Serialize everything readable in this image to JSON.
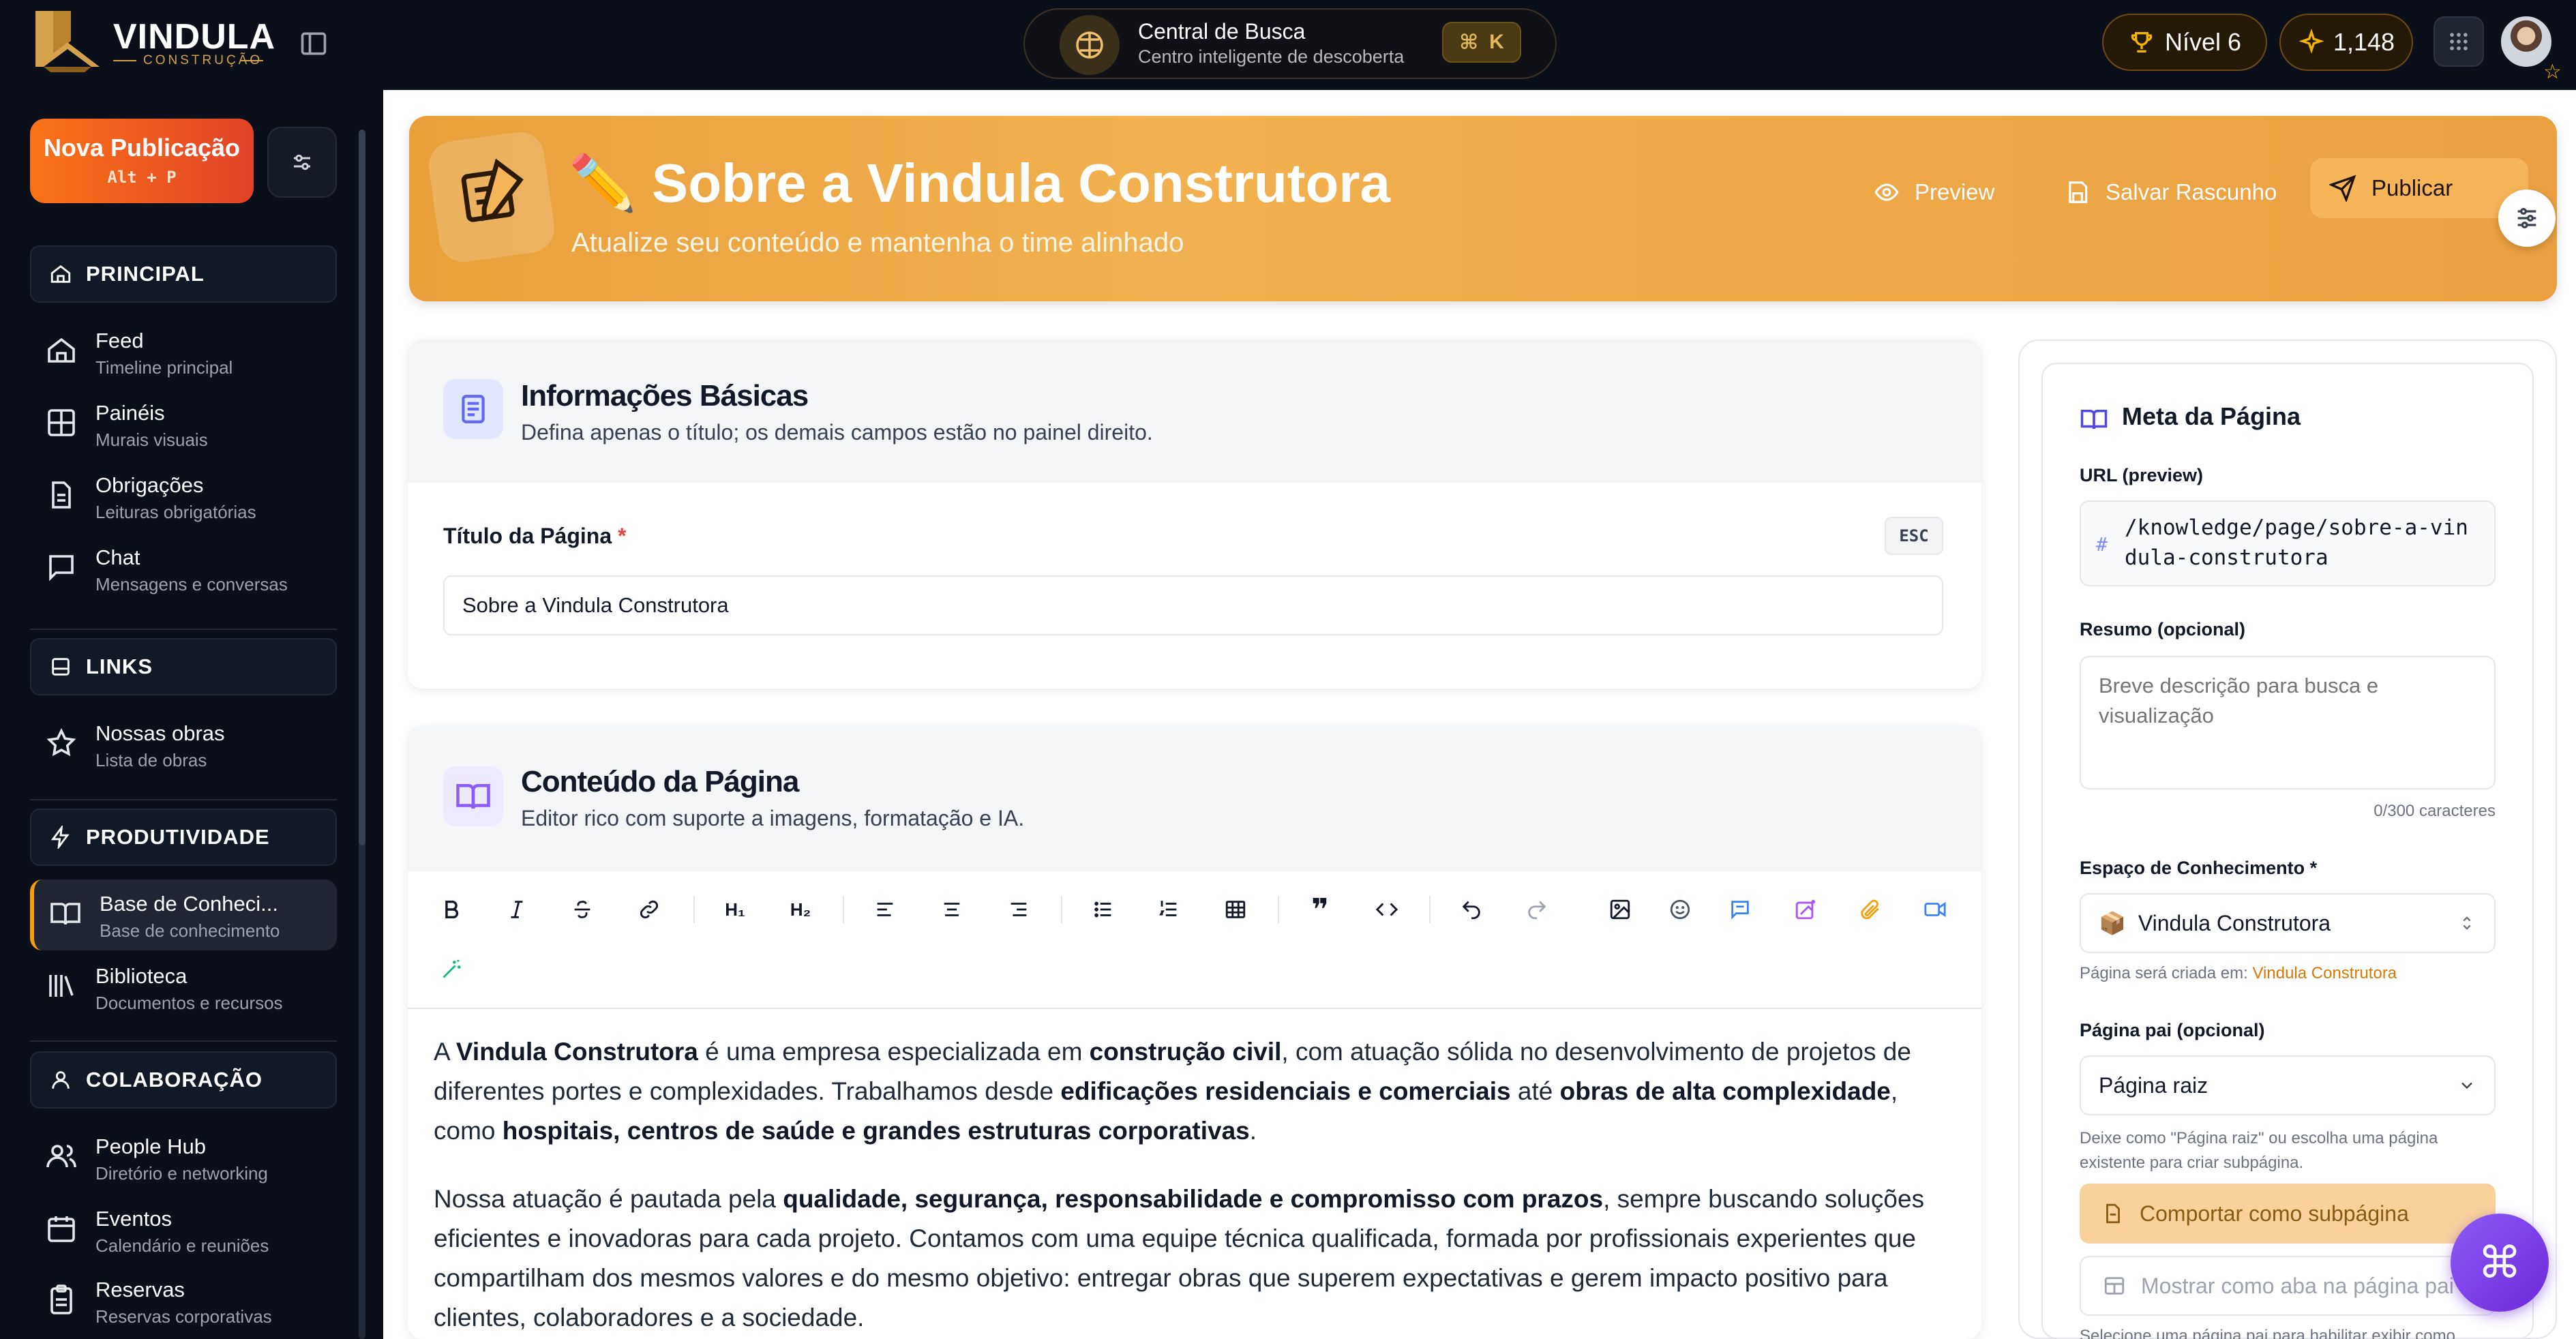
{
  "topbar": {
    "brand": "VINDULA",
    "brand_sub": "CONSTRUÇÃO",
    "search_title": "Central de Busca",
    "search_sub": "Centro inteligente de descoberta",
    "search_shortcut_key": "K",
    "level": "Nível 6",
    "points": "1,148"
  },
  "sidebar": {
    "new_post_label": "Nova Publicação",
    "new_post_shortcut": "Alt + P",
    "sections": [
      {
        "title": "PRINCIPAL",
        "items": [
          {
            "label": "Feed",
            "sub": "Timeline principal",
            "icon": "home-icon"
          },
          {
            "label": "Painéis",
            "sub": "Murais visuais",
            "icon": "grid-icon"
          },
          {
            "label": "Obrigações",
            "sub": "Leituras obrigatórias",
            "icon": "document-icon"
          },
          {
            "label": "Chat",
            "sub": "Mensagens e conversas",
            "icon": "chat-icon"
          }
        ]
      },
      {
        "title": "LINKS",
        "items": [
          {
            "label": "Nossas obras",
            "sub": "Lista de obras",
            "icon": "star-icon"
          }
        ]
      },
      {
        "title": "PRODUTIVIDADE",
        "items": [
          {
            "label": "Base de Conheci...",
            "sub": "Base de conhecimento",
            "icon": "book-icon",
            "active": true
          },
          {
            "label": "Biblioteca",
            "sub": "Documentos e recursos",
            "icon": "library-icon"
          }
        ]
      },
      {
        "title": "COLABORAÇÃO",
        "items": [
          {
            "label": "People Hub",
            "sub": "Diretório e networking",
            "icon": "people-icon"
          },
          {
            "label": "Eventos",
            "sub": "Calendário e reuniões",
            "icon": "calendar-icon"
          },
          {
            "label": "Reservas",
            "sub": "Reservas corporativas",
            "icon": "clipboard-icon"
          }
        ]
      }
    ]
  },
  "hero": {
    "emoji": "✏️",
    "title": "Sobre a Vindula Construtora",
    "subtitle": "Atualize seu conteúdo e mantenha o time alinhado",
    "preview_label": "Preview",
    "save_draft_label": "Salvar Rascunho",
    "publish_label": "Publicar"
  },
  "basic_info": {
    "title": "Informações Básicas",
    "subtitle": "Defina apenas o título; os demais campos estão no painel direito.",
    "field_label": "Título da Página",
    "required_mark": "*",
    "esc_label": "ESC",
    "title_value": "Sobre a Vindula Construtora"
  },
  "content_section": {
    "title": "Conteúdo da Página",
    "subtitle": "Editor rico com suporte a imagens, formatação e IA."
  },
  "editor": {
    "p1": [
      {
        "t": "A "
      },
      {
        "t": "Vindula Construtora",
        "b": true
      },
      {
        "t": " é uma empresa especializada em "
      },
      {
        "t": "construção civil",
        "b": true
      },
      {
        "t": ", com atuação sólida no desenvolvimento de projetos de diferentes portes e complexidades. Trabalhamos desde "
      },
      {
        "t": "edificações residenciais e comerciais",
        "b": true
      },
      {
        "t": " até "
      },
      {
        "t": "obras de alta complexidade",
        "b": true
      },
      {
        "t": ", como "
      },
      {
        "t": "hospitais, centros de saúde e grandes estruturas corporativas",
        "b": true
      },
      {
        "t": "."
      }
    ],
    "p2": [
      {
        "t": "Nossa atuação é pautada pela "
      },
      {
        "t": "qualidade, segurança, responsabilidade e compromisso com prazos",
        "b": true
      },
      {
        "t": ", sempre buscando soluções eficientes e inovadoras para cada projeto. Contamos com uma equipe técnica qualificada, formada por profissionais experientes que compartilham dos mesmos valores e do mesmo objetivo: entregar obras que superem expectativas e gerem impacto positivo para clientes, colaboradores e a sociedade."
      }
    ]
  },
  "meta": {
    "title": "Meta da Página",
    "url_label": "URL (preview)",
    "url_hash": "#",
    "url_value": "/knowledge/page/sobre-a-vindula-construtora",
    "summary_label": "Resumo (opcional)",
    "summary_placeholder": "Breve descrição para busca e visualização",
    "char_count": "0/300 caracteres",
    "space_label": "Espaço de Conhecimento",
    "space_value": "Vindula Construtora",
    "space_emoji": "📦",
    "space_help_prefix": "Página será criada em:",
    "space_help_link": "Vindula Construtora",
    "parent_label": "Página pai (opcional)",
    "parent_value": "Página raiz",
    "parent_help": "Deixe como \"Página raiz\" ou escolha uma página existente para criar subpágina.",
    "subpage_button": "Comportar como subpágina",
    "tab_button": "Mostrar como aba na página pai",
    "bottom_help": "Selecione uma página pai para habilitar exibir como"
  },
  "colors": {
    "accent": "#f0a33f",
    "brand_gold": "#d4a24c",
    "fab": "#7c3aed",
    "sidebar_bg": "#0b0f19"
  }
}
